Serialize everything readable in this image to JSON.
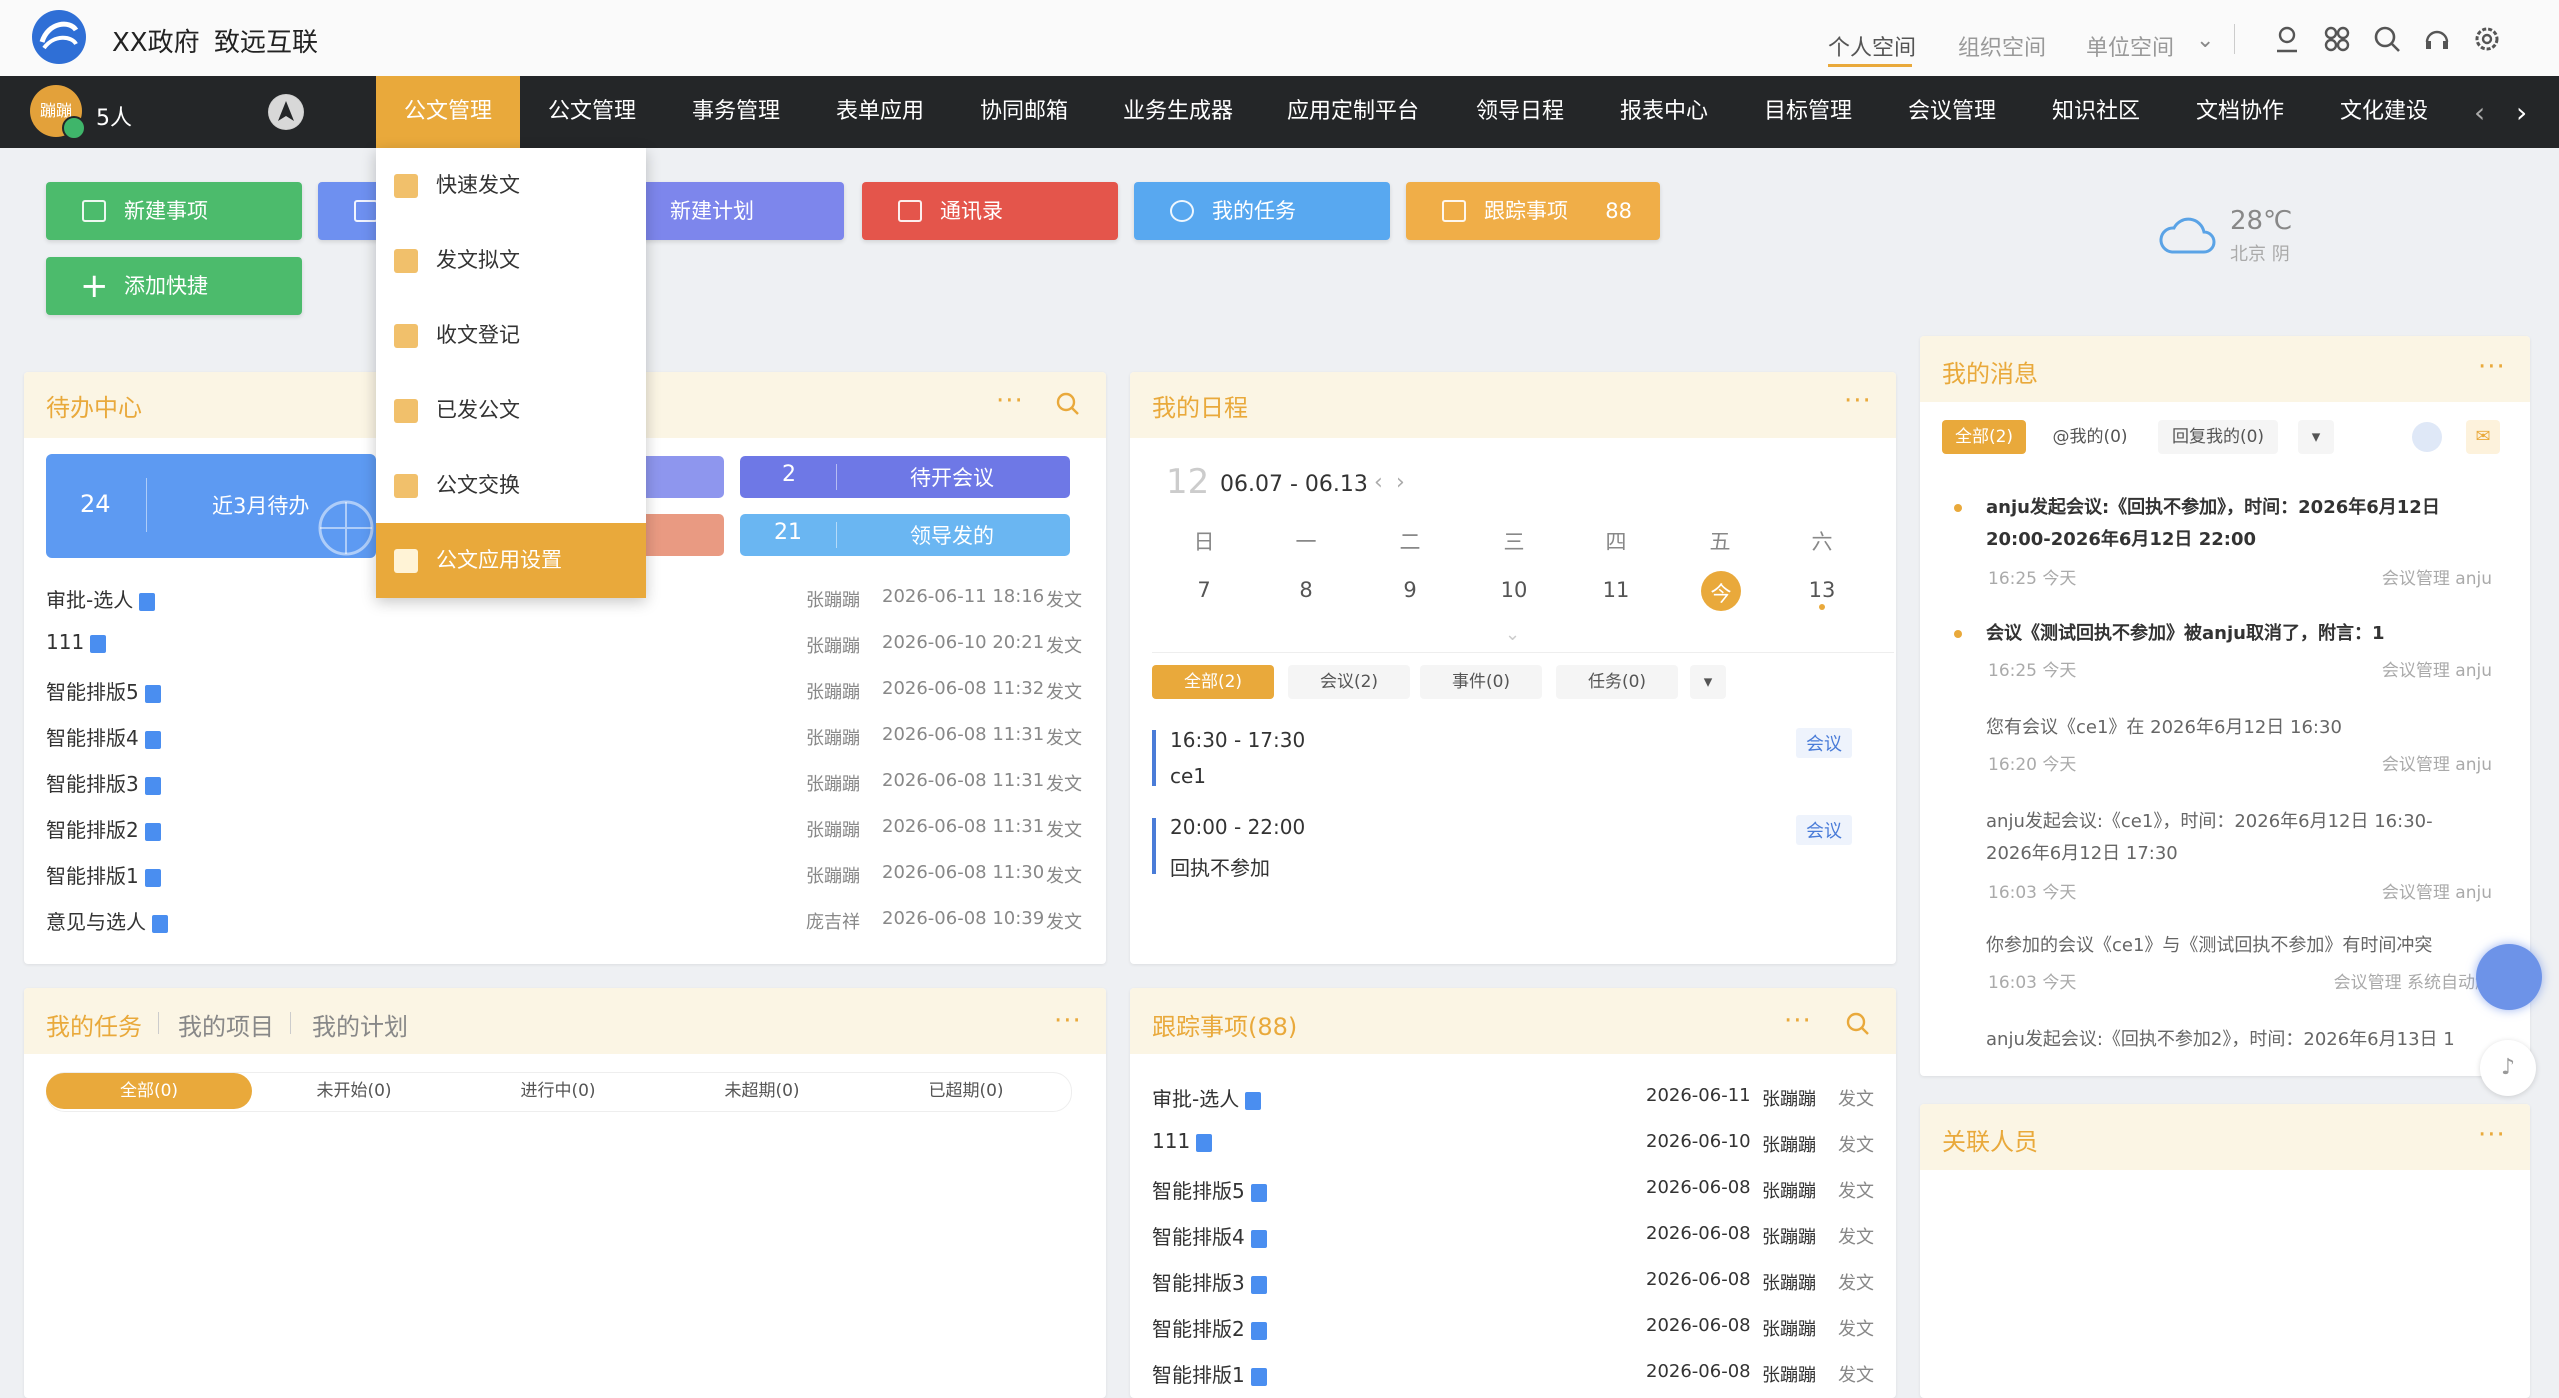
{
  "header": {
    "org_name": "XX政府",
    "brand": "致远互联",
    "space_tabs": [
      "个人空间",
      "组织空间",
      "单位空间"
    ],
    "icons": [
      "user-location-icon",
      "apps-icon",
      "search-icon",
      "headset-icon",
      "settings-icon"
    ]
  },
  "nav": {
    "avatar_text": "蹦蹦",
    "people_count": "5人",
    "items": [
      "公文管理",
      "公文管理",
      "事务管理",
      "表单应用",
      "协同邮箱",
      "业务生成器",
      "应用定制平台",
      "领导日程",
      "报表中心",
      "目标管理",
      "会议管理",
      "知识社区",
      "文档协作",
      "文化建设"
    ]
  },
  "dropdown": {
    "items": [
      "快速发文",
      "发文拟文",
      "收文登记",
      "已发公文",
      "公文交换",
      "公文应用设置"
    ]
  },
  "quick": {
    "new_item": "新建事项",
    "new_plan": "新建计划",
    "contacts": "通讯录",
    "my_tasks": "我的任务",
    "tracking": "跟踪事项",
    "tracking_count": "88",
    "add_shortcut": "添加快捷"
  },
  "weather": {
    "temp": "28℃",
    "desc": "北京 阴"
  },
  "todo": {
    "title": "待办中心",
    "stat_main": {
      "count": "24",
      "label": "近3月待办"
    },
    "stat_meeting": {
      "count": "2",
      "label": "待开会议"
    },
    "stat_leader": {
      "count": "21",
      "label": "领导发的"
    },
    "rows": [
      {
        "title": "审批-选人",
        "person": "张蹦蹦",
        "time": "2026-06-11 18:16",
        "type": "发文"
      },
      {
        "title": "111",
        "person": "张蹦蹦",
        "time": "2026-06-10 20:21",
        "type": "发文"
      },
      {
        "title": "智能排版5",
        "person": "张蹦蹦",
        "time": "2026-06-08 11:32",
        "type": "发文"
      },
      {
        "title": "智能排版4",
        "person": "张蹦蹦",
        "time": "2026-06-08 11:31",
        "type": "发文"
      },
      {
        "title": "智能排版3",
        "person": "张蹦蹦",
        "time": "2026-06-08 11:31",
        "type": "发文"
      },
      {
        "title": "智能排版2",
        "person": "张蹦蹦",
        "time": "2026-06-08 11:31",
        "type": "发文"
      },
      {
        "title": "智能排版1",
        "person": "张蹦蹦",
        "time": "2026-06-08 11:30",
        "type": "发文"
      },
      {
        "title": "意见与选人",
        "person": "庞吉祥",
        "time": "2026-06-08 10:39",
        "type": "发文"
      }
    ]
  },
  "schedule": {
    "title": "我的日程",
    "month": "12",
    "range": "06.07 - 06.13",
    "weekdays": [
      "日",
      "一",
      "二",
      "三",
      "四",
      "五",
      "六"
    ],
    "days": [
      "7",
      "8",
      "9",
      "10",
      "11",
      "今",
      "13"
    ],
    "tabs": [
      "全部(2)",
      "会议(2)",
      "事件(0)",
      "任务(0)"
    ],
    "events": [
      {
        "time": "16:30 - 17:30",
        "name": "ce1",
        "tag": "会议"
      },
      {
        "time": "20:00 - 22:00",
        "name": "回执不参加",
        "tag": "会议"
      }
    ]
  },
  "messages": {
    "title": "我的消息",
    "tabs": [
      "全部(2)",
      "@我的(0)",
      "回复我的(0)"
    ],
    "items": [
      {
        "text": "anju发起会议:《回执不参加》，时间：2026年6月12日 20:00-2026年6月12日 22:00",
        "time": "16:25 今天",
        "source": "会议管理 anju",
        "unread": true
      },
      {
        "text": "会议《测试回执不参加》被anju取消了，附言：1",
        "time": "16:25 今天",
        "source": "会议管理 anju",
        "unread": true
      },
      {
        "text": "您有会议《ce1》在 2026年6月12日 16:30",
        "time": "16:20 今天",
        "source": "会议管理 anju",
        "unread": false
      },
      {
        "text": "anju发起会议:《ce1》，时间：2026年6月12日 16:30-2026年6月12日 17:30",
        "time": "16:03 今天",
        "source": "会议管理 anju",
        "unread": false
      },
      {
        "text": "你参加的会议《ce1》与《测试回执不参加》有时间冲突",
        "time": "16:03 今天",
        "source": "会议管理 系统自动触",
        "unread": false
      },
      {
        "text": "anju发起会议:《回执不参加2》，时间：2026年6月13日 1",
        "time": "",
        "source": "",
        "unread": false
      }
    ]
  },
  "tasks": {
    "tabs": [
      "我的任务",
      "我的项目",
      "我的计划"
    ],
    "filters": [
      "全部(0)",
      "未开始(0)",
      "进行中(0)",
      "未超期(0)",
      "已超期(0)"
    ]
  },
  "tracking": {
    "title": "跟踪事项(88)",
    "rows": [
      {
        "title": "审批-选人",
        "date": "2026-06-11",
        "person": "张蹦蹦",
        "type": "发文"
      },
      {
        "title": "111",
        "date": "2026-06-10",
        "person": "张蹦蹦",
        "type": "发文"
      },
      {
        "title": "智能排版5",
        "date": "2026-06-08",
        "person": "张蹦蹦",
        "type": "发文"
      },
      {
        "title": "智能排版4",
        "date": "2026-06-08",
        "person": "张蹦蹦",
        "type": "发文"
      },
      {
        "title": "智能排版3",
        "date": "2026-06-08",
        "person": "张蹦蹦",
        "type": "发文"
      },
      {
        "title": "智能排版2",
        "date": "2026-06-08",
        "person": "张蹦蹦",
        "type": "发文"
      },
      {
        "title": "智能排版1",
        "date": "2026-06-08",
        "person": "张蹦蹦",
        "type": "发文"
      }
    ]
  },
  "related": {
    "title": "关联人员"
  },
  "colors": {
    "accent": "#e9a93b",
    "nav_bg": "#242628",
    "green": "#4cbb6c",
    "blue": "#6e90f0",
    "red": "#e4554b",
    "sky": "#58a8f0"
  }
}
